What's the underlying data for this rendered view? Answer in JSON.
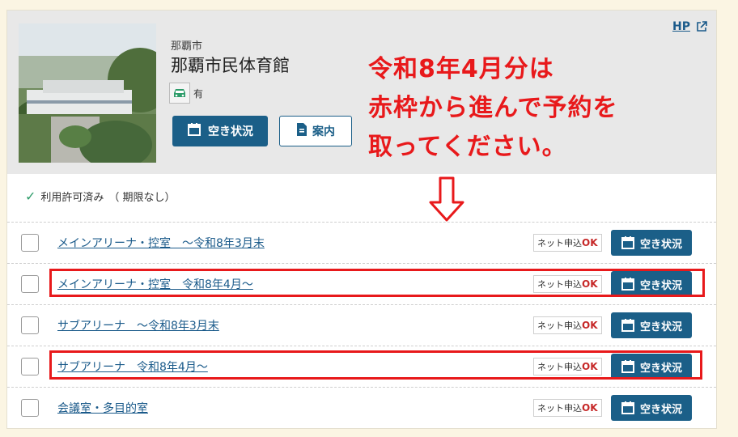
{
  "header": {
    "hp_link": "HP",
    "city": "那覇市",
    "facility_name": "那覇市民体育館",
    "parking_label": "有",
    "availability_button": "空き状況",
    "guide_button": "案内"
  },
  "annotation": {
    "line1": "令和8年4月分は",
    "line2": "赤枠から進んで予約を",
    "line3": "取ってください。"
  },
  "permit_status": {
    "label": "利用許可済み",
    "note": "（ 期限なし）"
  },
  "rooms": [
    {
      "name": "メインアリーナ・控室　～令和8年3月末",
      "net_label": "ネット申込",
      "net_ok": "OK",
      "availability": "空き状況",
      "highlighted": false
    },
    {
      "name": "メインアリーナ・控室　令和8年4月～",
      "net_label": "ネット申込",
      "net_ok": "OK",
      "availability": "空き状況",
      "highlighted": true
    },
    {
      "name": "サブアリーナ　～令和8年3月末",
      "net_label": "ネット申込",
      "net_ok": "OK",
      "availability": "空き状況",
      "highlighted": false
    },
    {
      "name": "サブアリーナ　令和8年4月～",
      "net_label": "ネット申込",
      "net_ok": "OK",
      "availability": "空き状況",
      "highlighted": true
    },
    {
      "name": "会議室・多目的室",
      "net_label": "ネット申込",
      "net_ok": "OK",
      "availability": "空き状況",
      "highlighted": false
    }
  ],
  "colors": {
    "accent": "#1b5f88",
    "annotation_red": "#e8191b",
    "ok_red": "#c62828",
    "page_bg": "#fbf5e3"
  },
  "icons": {
    "calendar": "calendar-icon",
    "document": "document-icon",
    "car": "car-icon",
    "external": "external-link-icon",
    "check": "checkmark-icon",
    "arrow": "down-arrow-icon"
  }
}
